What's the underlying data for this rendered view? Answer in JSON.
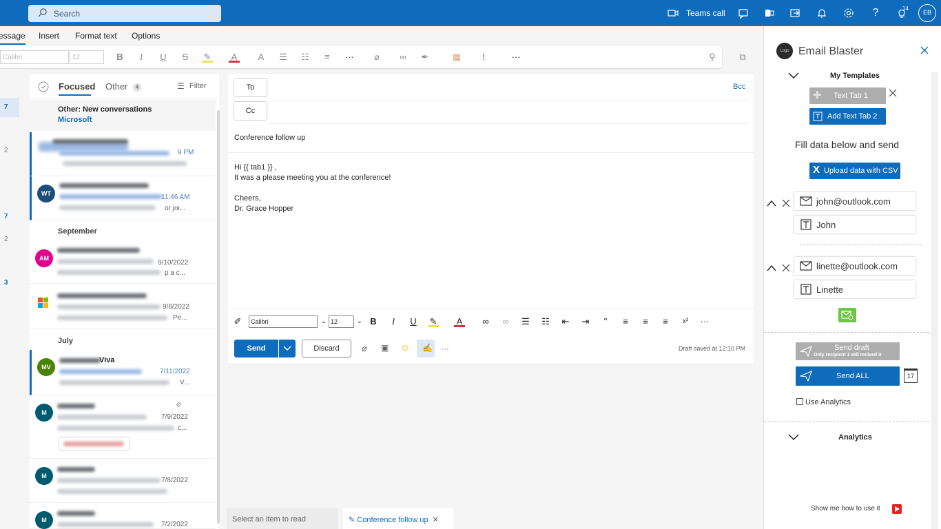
{
  "topbar": {
    "search_placeholder": "Search",
    "teams_call": "Teams call",
    "notification_count": "14",
    "avatar_initials": "EB"
  },
  "ribbon": {
    "tabs": [
      "essage",
      "Insert",
      "Format text",
      "Options"
    ],
    "font": "Calibri",
    "size": "12"
  },
  "left_rail": {
    "numbers": [
      "7",
      "2",
      "7",
      "2",
      "3"
    ]
  },
  "mail_list": {
    "tabs": {
      "focused": "Focused",
      "other": "Other",
      "other_count": "4",
      "filter": "Filter"
    },
    "other_banner": {
      "title": "Other: New conversations",
      "sender": "Microsoft"
    },
    "sections": [
      "September",
      "July"
    ],
    "items": [
      {
        "initials": "WT",
        "date": "11:46 AM",
        "snippet_tail": "or joi..."
      },
      {
        "initials": "AM",
        "date": "9/10/2022",
        "snippet_tail": "p a c..."
      },
      {
        "initials": "",
        "date": "9/8/2022",
        "snippet_tail": "Pe..."
      },
      {
        "initials": "MV",
        "date": "7/11/2022",
        "sender_tail": "Viva",
        "snippet_tail": "V..."
      },
      {
        "initials": "M",
        "date": "7/9/2022",
        "snippet_tail": "c..."
      },
      {
        "initials": "M",
        "date": "7/8/2022"
      },
      {
        "initials": "M",
        "date": "7/2/2022"
      }
    ],
    "first_item_date_tail": "9 PM"
  },
  "compose": {
    "to_label": "To",
    "cc_label": "Cc",
    "bcc_label": "Bcc",
    "subject": "Conference follow up",
    "body": [
      "Hi {{ tab1 }} ,",
      "It was a please meeting you at the conference!",
      "",
      "Cheers,",
      "Dr. Grace Hopper"
    ],
    "format_font": "Calibri",
    "format_size": "12",
    "send": "Send",
    "discard": "Discard",
    "draft_status": "Draft saved at 12:10 PM"
  },
  "bottom_tabs": {
    "read": "Select an item to read",
    "conference": "Conference follow up"
  },
  "panel": {
    "logo_text": "Logo",
    "title": "Email Blaster",
    "my_templates": "My Templates",
    "text_tab_1": "Text Tab 1",
    "add_text_tab_2": "Add Text Tab 2",
    "fill_data": "Fill data below and send",
    "upload_csv": "Upload data with CSV",
    "recipients": [
      {
        "email": "john@outlook.com",
        "name": "John"
      },
      {
        "email": "linette@outlook.com",
        "name": "Linette"
      }
    ],
    "send_draft": "Send draft",
    "send_draft_note": "Only recipient 1 will recived it",
    "send_all": "Send ALL",
    "calendar_day": "17",
    "use_analytics": "Use Analytics",
    "analytics": "Analytics",
    "show_me": "Show me how to use it"
  },
  "colors": {
    "brand": "#0f6cbd",
    "disabled": "#adadad",
    "addin_green": "#6cc644",
    "youtube_red": "#e62117"
  }
}
